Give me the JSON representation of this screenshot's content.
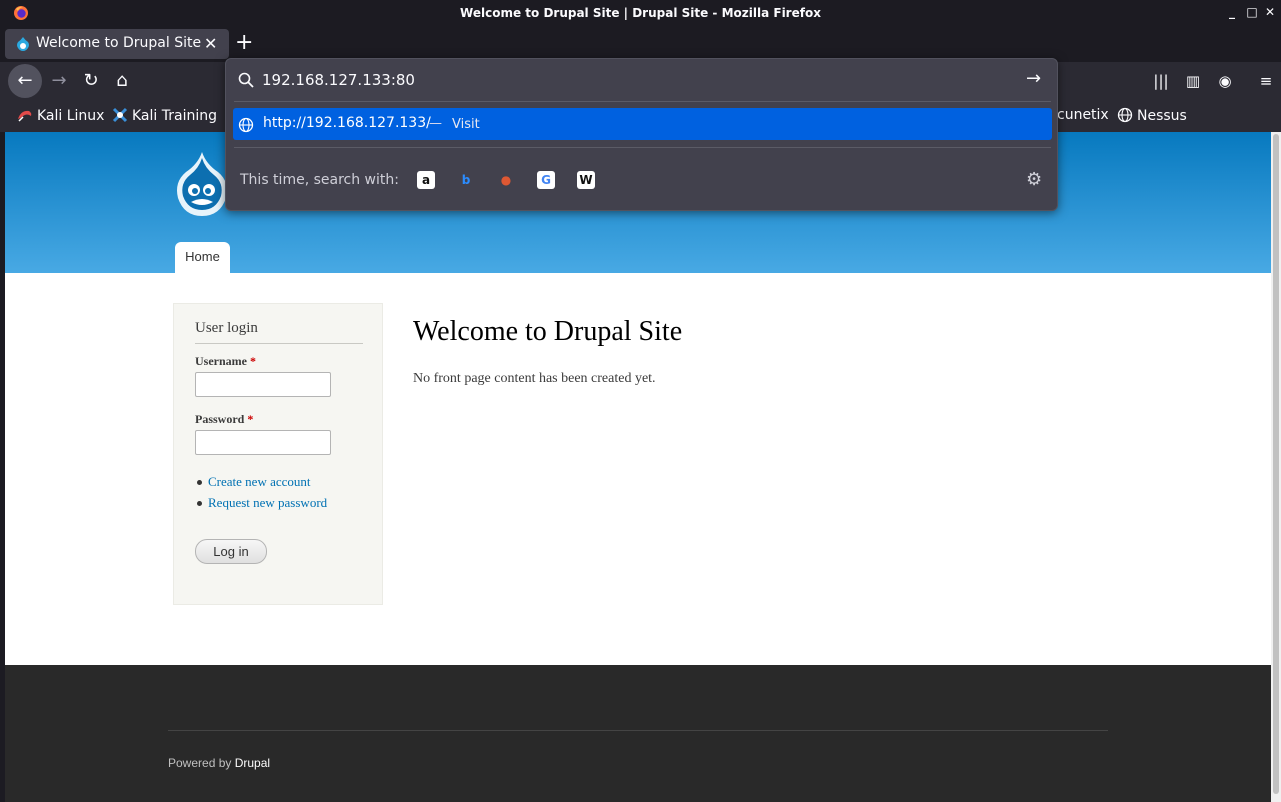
{
  "window": {
    "title": "Welcome to Drupal Site | Drupal Site - Mozilla Firefox",
    "controls": [
      "_",
      "□",
      "✕"
    ]
  },
  "tab": {
    "label": "Welcome to Drupal Site | Drupal Site",
    "close": "✕",
    "new_tab": "+"
  },
  "nav": {
    "back": "←",
    "forward": "→",
    "reload": "↻",
    "home": "⌂",
    "library": "|||",
    "sidebar": "▥",
    "account": "◉",
    "menu": "≡"
  },
  "bookmarks": [
    {
      "label": "Kali Linux",
      "icon": "kali-dragon-icon"
    },
    {
      "label": "Kali Training",
      "icon": "kali-training-icon"
    },
    {
      "label": "cunetix",
      "icon": "acunetix-icon"
    },
    {
      "label": "Nessus",
      "icon": "globe-icon"
    }
  ],
  "urlbar": {
    "value": "192.168.127.133:80",
    "go": "→",
    "suggestion": {
      "url": "http://192.168.127.133/",
      "separator": "—",
      "action": "Visit"
    },
    "search_with": "This time, search with:",
    "engines": [
      {
        "name": "amazon-icon",
        "glyph": "a",
        "bg": "#ffffff",
        "fg": "#111111"
      },
      {
        "name": "bing-icon",
        "glyph": "b",
        "bg": "transparent",
        "fg": "#2b8cff"
      },
      {
        "name": "duckduckgo-icon",
        "glyph": "●",
        "bg": "transparent",
        "fg": "#de5833"
      },
      {
        "name": "google-icon",
        "glyph": "G",
        "bg": "#ffffff",
        "fg": "#4285f4"
      },
      {
        "name": "wikipedia-icon",
        "glyph": "W",
        "bg": "#ffffff",
        "fg": "#111111"
      }
    ],
    "settings": "⚙"
  },
  "site": {
    "home_tab": "Home",
    "login": {
      "heading": "User login",
      "username_label": "Username",
      "password_label": "Password",
      "required": "*",
      "links": [
        "Create new account",
        "Request new password"
      ],
      "button": "Log in"
    },
    "title": "Welcome to Drupal Site",
    "body": "No front page content has been created yet.",
    "footer": {
      "powered": "Powered by",
      "link": "Drupal"
    }
  },
  "colors": {
    "header_top": "#0779bf",
    "header_bottom": "#48a9e4",
    "accent": "#0061e0",
    "link": "#0071b3"
  }
}
